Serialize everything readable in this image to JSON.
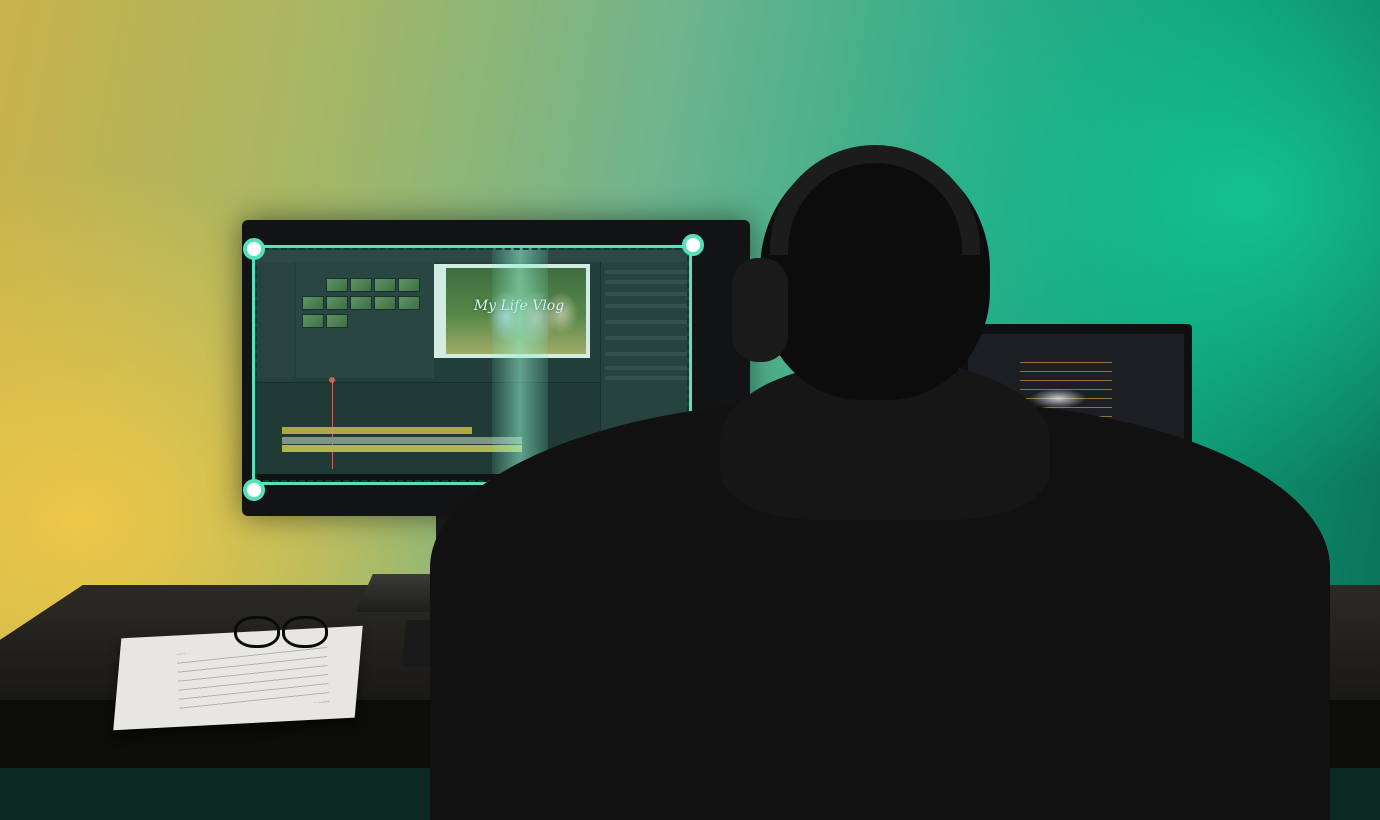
{
  "scene": {
    "description_label": "",
    "colors": {
      "wall_warm": "#e8c652",
      "wall_cool": "#1aa07c",
      "accent": "#58e1b8"
    }
  },
  "main_monitor": {
    "viewer_title": "My Life Vlog"
  },
  "icons": [
    "selection-handle-icon",
    "playhead-icon"
  ]
}
